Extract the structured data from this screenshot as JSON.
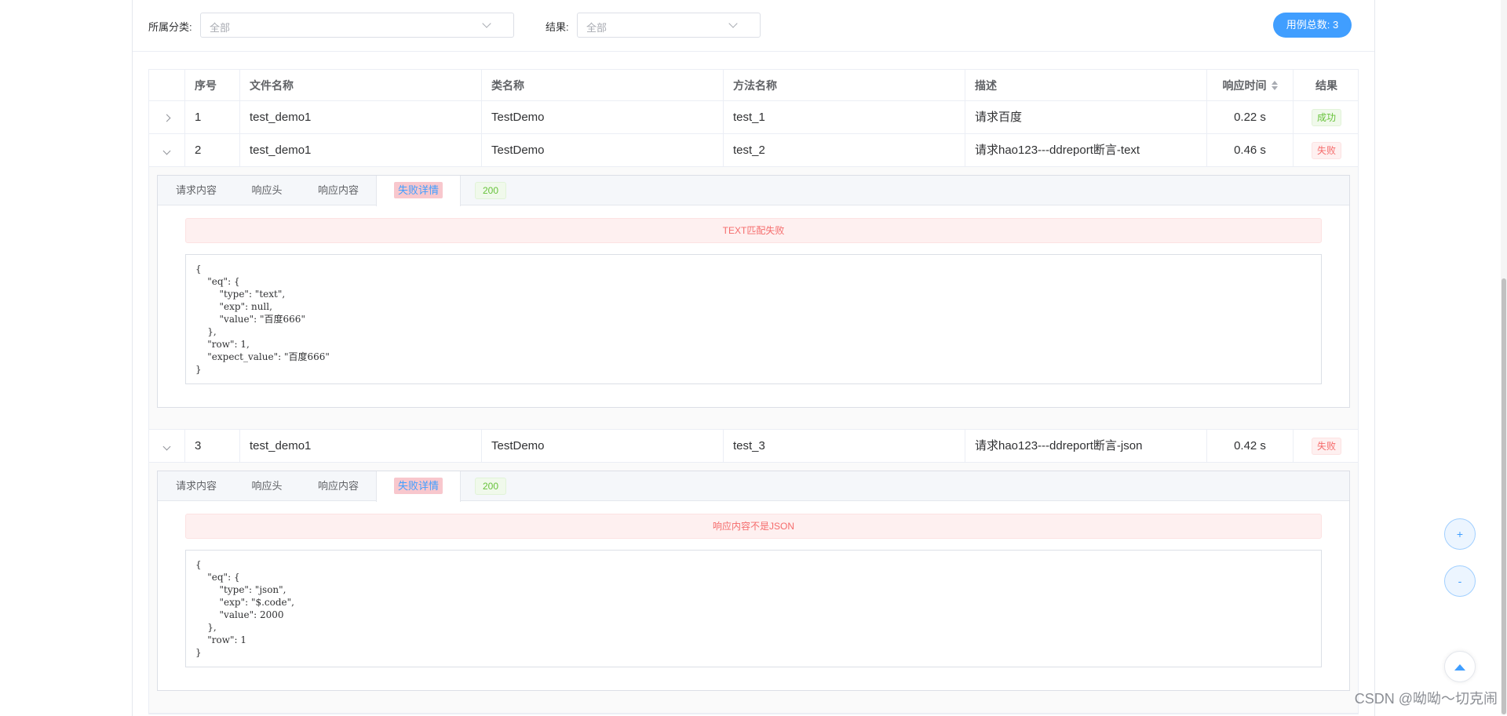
{
  "filters": {
    "category_label": "所属分类:",
    "category_value": "全部",
    "result_label": "结果:",
    "result_value": "全部",
    "total_button": "用例总数: 3"
  },
  "table": {
    "headers": [
      "",
      "序号",
      "文件名称",
      "类名称",
      "方法名称",
      "描述",
      "响应时间",
      "结果"
    ],
    "rows": [
      {
        "index": "1",
        "file": "test_demo1",
        "class": "TestDemo",
        "method": "test_1",
        "desc": "请求百度",
        "time": "0.22 s",
        "result": "成功",
        "status": "success",
        "expanded": false
      },
      {
        "index": "2",
        "file": "test_demo1",
        "class": "TestDemo",
        "method": "test_2",
        "desc": "请求hao123---ddreport断言-text",
        "time": "0.46 s",
        "result": "失败",
        "status": "fail",
        "expanded": true
      },
      {
        "index": "3",
        "file": "test_demo1",
        "class": "TestDemo",
        "method": "test_3",
        "desc": "请求hao123---ddreport断言-json",
        "time": "0.42 s",
        "result": "失败",
        "status": "fail",
        "expanded": true
      }
    ]
  },
  "details": [
    {
      "tabs": [
        "请求内容",
        "响应头",
        "响应内容",
        "失败详情"
      ],
      "active_tab": "失败详情",
      "status_code": "200",
      "alert": "TEXT匹配失败",
      "code": "{\n    \"eq\": {\n        \"type\": \"text\",\n        \"exp\": null,\n        \"value\": \"百度666\"\n    },\n    \"row\": 1,\n    \"expect_value\": \"百度666\"\n}"
    },
    {
      "tabs": [
        "请求内容",
        "响应头",
        "响应内容",
        "失败详情"
      ],
      "active_tab": "失败详情",
      "status_code": "200",
      "alert": "响应内容不是JSON",
      "code": "{\n    \"eq\": {\n        \"type\": \"json\",\n        \"exp\": \"$.code\",\n        \"value\": 2000\n    },\n    \"row\": 1\n}"
    }
  ],
  "fabs": {
    "zoom_in": "+",
    "zoom_out": "-"
  },
  "watermark": "CSDN @呦呦～切克闹",
  "colors": {
    "accent": "#409eff",
    "success": "#67c23a",
    "fail": "#f56c6c"
  }
}
